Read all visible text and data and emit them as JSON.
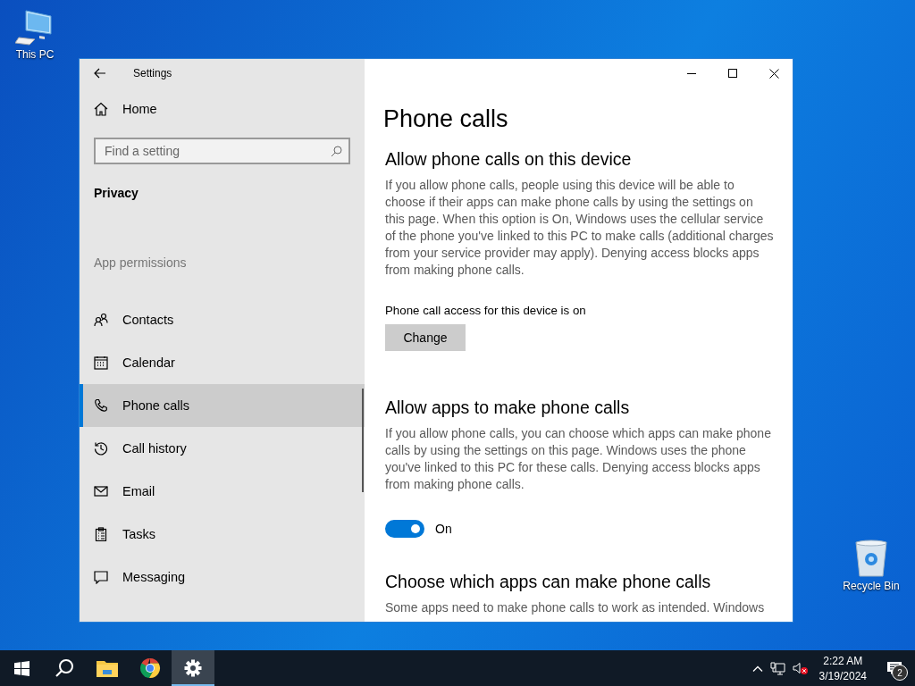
{
  "desktop_icons": [
    {
      "kind": "computer",
      "label": "This PC"
    },
    {
      "kind": "recycle-bin",
      "label": "Recycle Bin"
    }
  ],
  "window": {
    "title": "Settings"
  },
  "sidebar": {
    "home": "Home",
    "search": {
      "placeholder": "Find a setting"
    },
    "section": "Privacy",
    "group": "App permissions",
    "items": [
      {
        "kind": "contacts",
        "label": "Contacts",
        "selected": false
      },
      {
        "kind": "calendar",
        "label": "Calendar",
        "selected": false
      },
      {
        "kind": "phone",
        "label": "Phone calls",
        "selected": true
      },
      {
        "kind": "history",
        "label": "Call history",
        "selected": false
      },
      {
        "kind": "email",
        "label": "Email",
        "selected": false
      },
      {
        "kind": "tasks",
        "label": "Tasks",
        "selected": false
      },
      {
        "kind": "messaging",
        "label": "Messaging",
        "selected": false
      }
    ]
  },
  "content": {
    "title": "Phone calls",
    "sections": [
      {
        "heading": "Allow phone calls on this device",
        "description": "If you allow phone calls, people using this device will be able to choose if their apps can make phone calls by using the settings on this page. When this option is On, Windows uses the cellular service of the phone you've linked to this PC to make calls (additional charges from your service provider may apply). Denying access blocks apps from making phone calls.",
        "status": "Phone call access for this device is on",
        "button": "Change"
      },
      {
        "heading": "Allow apps to make phone calls",
        "description": "If you allow phone calls, you can choose which apps can make phone calls by using the settings on this page. Windows uses the phone you've linked to this PC for these calls. Denying access blocks apps from making phone calls.",
        "toggle": {
          "on": true,
          "label": "On"
        }
      },
      {
        "heading": "Choose which apps can make phone calls",
        "description": "Some apps need to make phone calls to work as intended. Windows"
      }
    ]
  },
  "taskbar": {
    "apps": [
      {
        "kind": "start",
        "active": false
      },
      {
        "kind": "search",
        "active": false
      },
      {
        "kind": "explorer",
        "active": false
      },
      {
        "kind": "chrome",
        "active": false
      },
      {
        "kind": "settings",
        "active": true
      }
    ],
    "tray": {
      "time": "2:22 AM",
      "date": "3/19/2024",
      "notifications": "2"
    }
  }
}
